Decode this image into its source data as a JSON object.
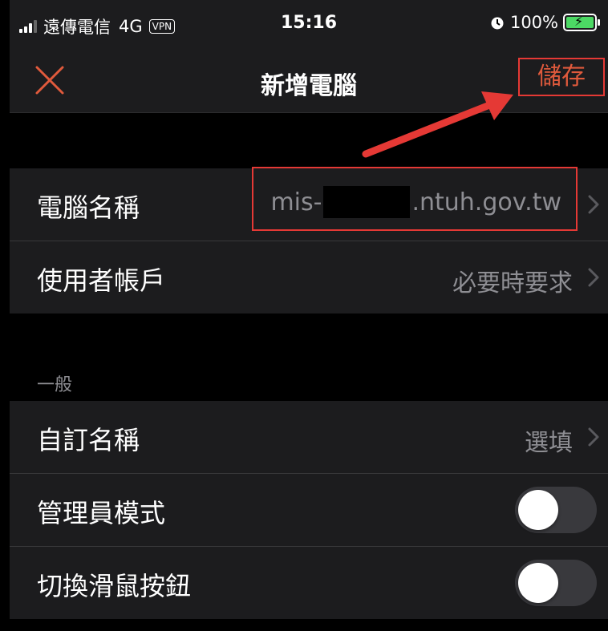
{
  "status_bar": {
    "carrier": "遠傳電信",
    "network": "4G",
    "vpn": "VPN",
    "time": "15:16",
    "battery": "100%"
  },
  "nav": {
    "title": "新增電腦",
    "save_label": "儲存",
    "close_icon": "close-x-icon"
  },
  "connection": {
    "rows": [
      {
        "label": "電腦名稱",
        "value_prefix": "mis-",
        "value_suffix": ".ntuh.gov.tw"
      },
      {
        "label": "使用者帳戶",
        "value": "必要時要求"
      }
    ]
  },
  "general": {
    "header": "一般",
    "rows": [
      {
        "label": "自訂名稱",
        "value": "選填"
      },
      {
        "label": "管理員模式",
        "toggle_on": false
      },
      {
        "label": "切換滑鼠按鈕",
        "toggle_on": false
      }
    ]
  },
  "colors": {
    "accent": "#e05a3c",
    "highlight_box": "#e53935",
    "background": "#000000",
    "group_bg": "#1c1c1e"
  }
}
